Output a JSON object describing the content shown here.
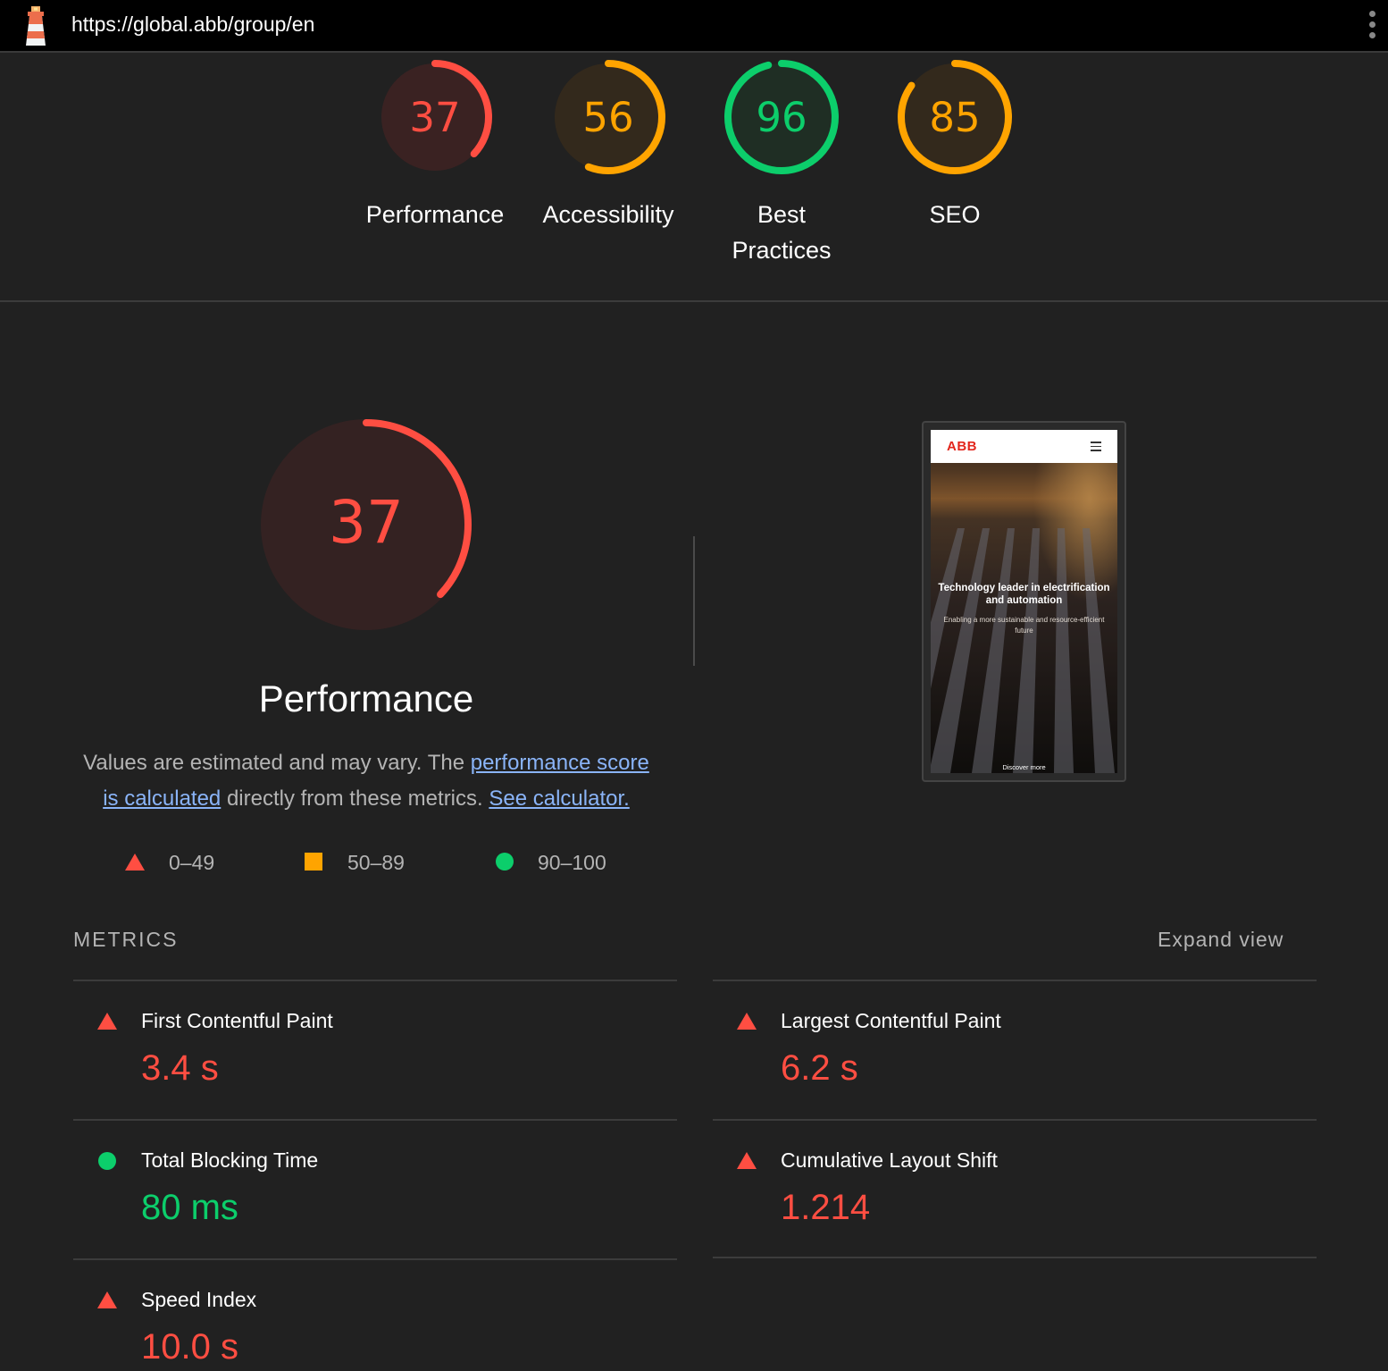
{
  "header": {
    "url": "https://global.abb/group/en"
  },
  "colors": {
    "fail": "#ff4e42",
    "average": "#ffa400",
    "pass": "#0cce6b",
    "background": "#212121"
  },
  "score_gauges": [
    {
      "score": "37",
      "label": "Performance",
      "level": "fail"
    },
    {
      "score": "56",
      "label": "Accessibility",
      "level": "average"
    },
    {
      "score": "96",
      "label_line1": "Best",
      "label_line2": "Practices",
      "level": "pass"
    },
    {
      "score": "85",
      "label": "SEO",
      "level": "average"
    }
  ],
  "performance": {
    "score": "37",
    "title": "Performance",
    "description_start": "Values are estimated and may vary. The ",
    "link_score": "performance score is calculated",
    "description_mid": " directly from these metrics. ",
    "link_calculator": "See calculator."
  },
  "legend": [
    {
      "range": "0–49",
      "icon": "triangle-icon"
    },
    {
      "range": "50–89",
      "icon": "square-icon"
    },
    {
      "range": "90–100",
      "icon": "circle-icon"
    }
  ],
  "screenshot": {
    "logo": "ABB",
    "headline": "Technology leader in electrification and automation",
    "subtitle": "Enabling a more sustainable and resource-efficient future",
    "cta": "Discover more"
  },
  "metrics": {
    "heading": "METRICS",
    "expand_label": "Expand view",
    "items": [
      {
        "title": "First Contentful Paint",
        "value": "3.4 s",
        "level": "fail"
      },
      {
        "title": "Largest Contentful Paint",
        "value": "6.2 s",
        "level": "fail"
      },
      {
        "title": "Total Blocking Time",
        "value": "80 ms",
        "level": "pass"
      },
      {
        "title": "Cumulative Layout Shift",
        "value": "1.214",
        "level": "fail"
      },
      {
        "title": "Speed Index",
        "value": "10.0 s",
        "level": "fail"
      }
    ]
  }
}
